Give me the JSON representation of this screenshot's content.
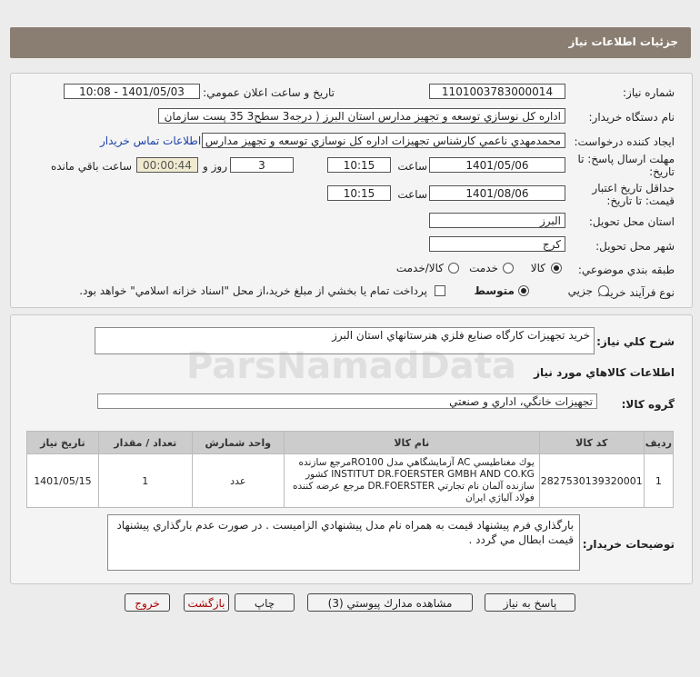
{
  "header": {
    "title": "جزئيات اطلاعات نياز"
  },
  "form": {
    "need_number_label": "شماره نياز:",
    "need_number": "1101003783000014",
    "announce_label": "تاريخ و ساعت اعلان عمومي:",
    "announce_value": "1401/05/03 - 10:08",
    "buyer_org_label": "نام دستگاه خريدار:",
    "buyer_org": "اداره كل نوسازي   توسعه و تجهيز مدارس استان البرز ( درجه3  سطح3  35 پست سازمان",
    "requester_label": "ايجاد كننده درخواست:",
    "requester": "محمدمهدي ناعمي كارشناس تجهيزات اداره كل نوسازي   توسعه و تجهيز مدارس",
    "contact_link": "اطلاعات تماس خريدار",
    "deadline_label_1": "مهلت ارسال پاسخ: تا",
    "deadline_label_2": "تاريخ:",
    "deadline_date": "1401/05/06",
    "time_label": "ساعت",
    "deadline_time": "10:15",
    "days_value": "3",
    "days_label": "روز و",
    "remaining_time": "00:00:44",
    "remaining_label": "ساعت باقي مانده",
    "validity_label_1": "حداقل تاريخ اعتبار",
    "validity_label_2": "قيمت: تا تاريخ:",
    "validity_date": "1401/08/06",
    "validity_time_label": "ساعت",
    "validity_time": "10:15",
    "province_label": "استان محل تحويل:",
    "province": "البرز",
    "city_label": "شهر محل تحويل:",
    "city": "كرج",
    "category_label": "طبقه بندي موضوعي:",
    "category_options": [
      "كالا",
      "خدمت",
      "كالا/خدمت"
    ],
    "process_label": "نوع فرآيند خريد :",
    "process_options": [
      "جزيي",
      "متوسط"
    ],
    "payment_note": "پرداخت تمام يا بخشي از مبلغ خريد،از محل \"اسناد خزانه اسلامي\" خواهد بود."
  },
  "summary": {
    "label": "شرح كلي نياز:",
    "value": "خريد تجهيزات كارگاه صنايع فلزي هنرستانهاي استان البرز"
  },
  "goods_section": {
    "title": "اطلاعات كالاهاي مورد نياز",
    "group_label": "گروه كالا:",
    "group_value": "تجهيزات خانگي، اداري و صنعتي"
  },
  "table": {
    "headers": [
      "رديف",
      "كد كالا",
      "نام كالا",
      "واحد شمارش",
      "تعداد / مقدار",
      "تاريخ نياز"
    ],
    "rows": [
      {
        "index": "1",
        "code": "2827530139320001",
        "name": "يوك مغناطيسي AC آزمايشگاهي مدل RO100مرجع سازنده INSTITUT DR.FOERSTER GMBH AND CO.KG كشور سازنده آلمان نام تجارتي DR.FOERSTER مرجع عرضه كننده فولاد آلياژي ايران",
        "unit": "عدد",
        "qty": "1",
        "date": "1401/05/15"
      }
    ]
  },
  "buyer_notes": {
    "label": "توضيحات خريدار:",
    "value": "بارگذاري فرم پيشنهاد قيمت به همراه نام مدل پيشنهادي الزاميست . در صورت عدم بارگذاري پيشنهاد قيمت ابطال مي گردد ."
  },
  "buttons": {
    "reply": "پاسخ به نياز",
    "view_docs": "مشاهده مدارك پيوستي (3)",
    "print": "چاپ",
    "back": "بازگشت",
    "exit": "خروج"
  },
  "watermark": {
    "brand": "ParsNamadData"
  },
  "colors": {
    "header_bg": "#8a7e72",
    "link": "#1a3faa",
    "exit_text": "#a00000"
  }
}
